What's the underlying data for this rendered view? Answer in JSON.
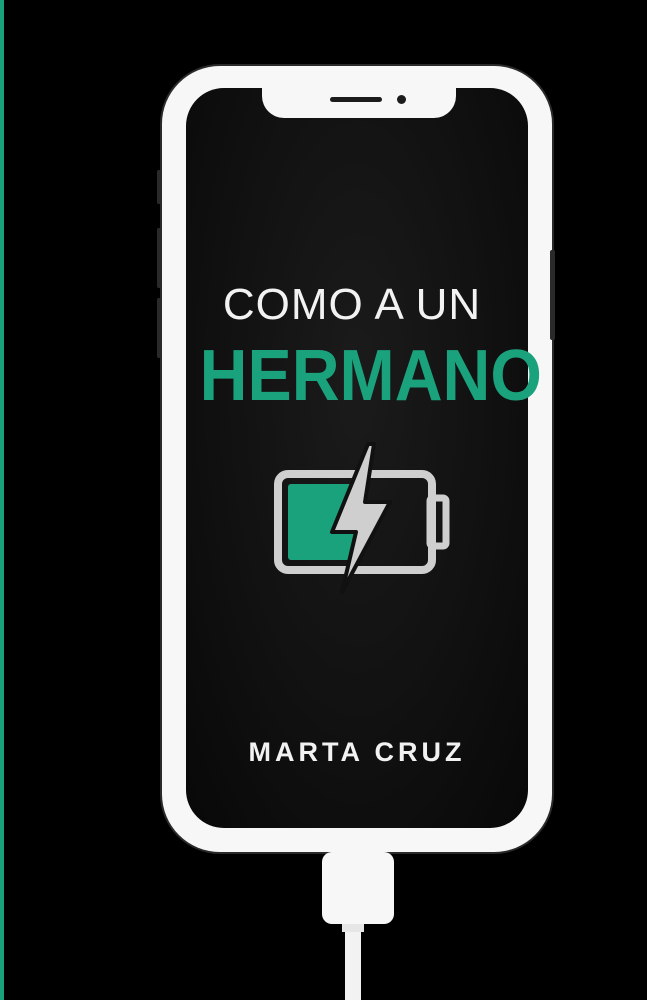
{
  "cover": {
    "title_line1": "COMO A UN",
    "title_line2": "HERMANO",
    "author": "MARTA CRUZ"
  },
  "icons": {
    "battery": "charging-battery-icon",
    "cable": "charging-cable-icon"
  },
  "battery_charge_fraction": 0.5,
  "colors": {
    "background": "#000000",
    "accent": "#1aa27d",
    "phone_frame": "#f7f7f7",
    "text": "#f2f2f2",
    "battery_outline": "#cfcfcf"
  }
}
